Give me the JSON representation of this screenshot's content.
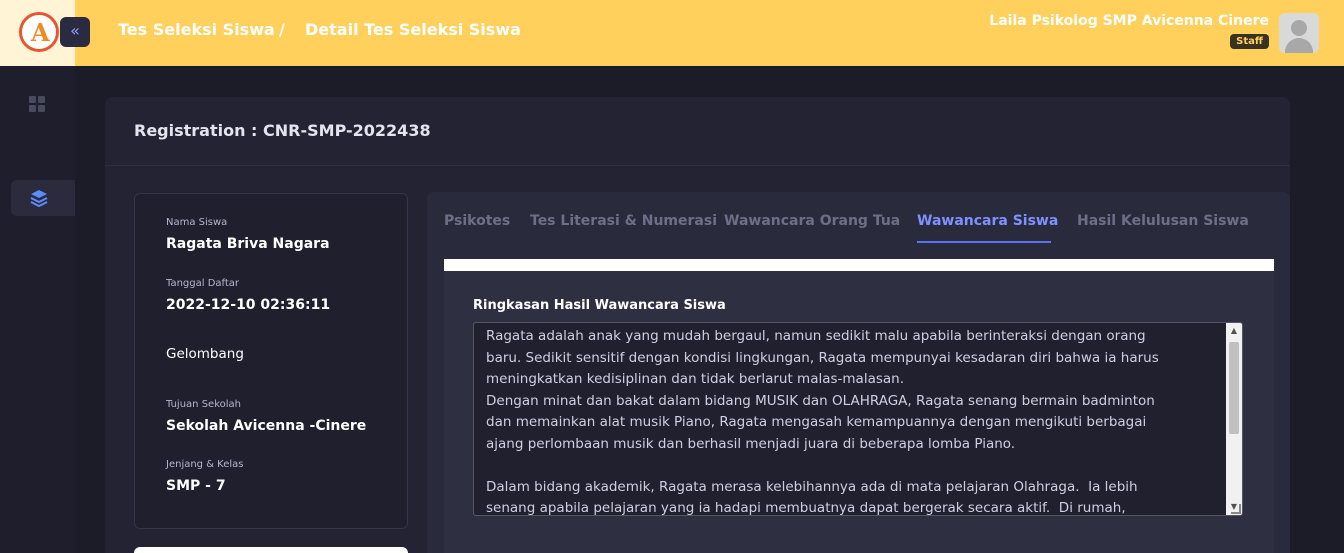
{
  "header": {
    "logo_letter": "A",
    "collapse_icon": "«",
    "breadcrumb_1": "Tes Seleksi Siswa",
    "breadcrumb_sep": "/",
    "breadcrumb_2": "Detail Tes Seleksi Siswa",
    "user_name": "Laila Psikolog SMP Avicenna Cinere",
    "user_role": "Staff"
  },
  "sidebar": {
    "items": [
      {
        "icon": "dashboard-icon"
      },
      {
        "icon": "layers-icon",
        "active": true
      }
    ]
  },
  "registration": {
    "title": "Registration : CNR-SMP-2022438"
  },
  "student": {
    "name_label": "Nama Siswa",
    "name": "Ragata Briva Nagara",
    "date_label": "Tanggal Daftar",
    "date": "2022-12-10 02:36:11",
    "wave_label": "Gelombang",
    "school_label": "Tujuan Sekolah",
    "school": "Sekolah Avicenna -Cinere",
    "level_label": "Jenjang & Kelas",
    "level": "SMP - 7"
  },
  "tabs": [
    {
      "label": "Psikotes"
    },
    {
      "label": "Tes Literasi & Numerasi"
    },
    {
      "label": "Wawancara Orang Tua"
    },
    {
      "label": "Wawancara Siswa",
      "active": true
    },
    {
      "label": "Hasil Kelulusan Siswa"
    }
  ],
  "interview": {
    "label": "Ringkasan Hasil Wawancara Siswa",
    "text": "Ragata adalah anak yang mudah bergaul, namun sedikit malu apabila berinteraksi dengan orang\nbaru. Sedikit sensitif dengan kondisi lingkungan, Ragata mempunyai kesadaran diri bahwa ia harus\nmeningkatkan kedisiplinan dan tidak berlarut malas-malasan.\nDengan minat dan bakat dalam bidang MUSIK dan OLAHRAGA, Ragata senang bermain badminton\ndan memainkan alat musik Piano, Ragata mengasah kemampuannya dengan mengikuti berbagai\najang perlombaan musik dan berhasil menjadi juara di beberapa lomba Piano.\n\nDalam bidang akademik, Ragata merasa kelebihannya ada di mata pelajaran Olahraga.  Ia lebih\nsenang apabila pelajaran yang ia hadapi membuatnya dapat bergerak secara aktif.  Di rumah,"
  }
}
